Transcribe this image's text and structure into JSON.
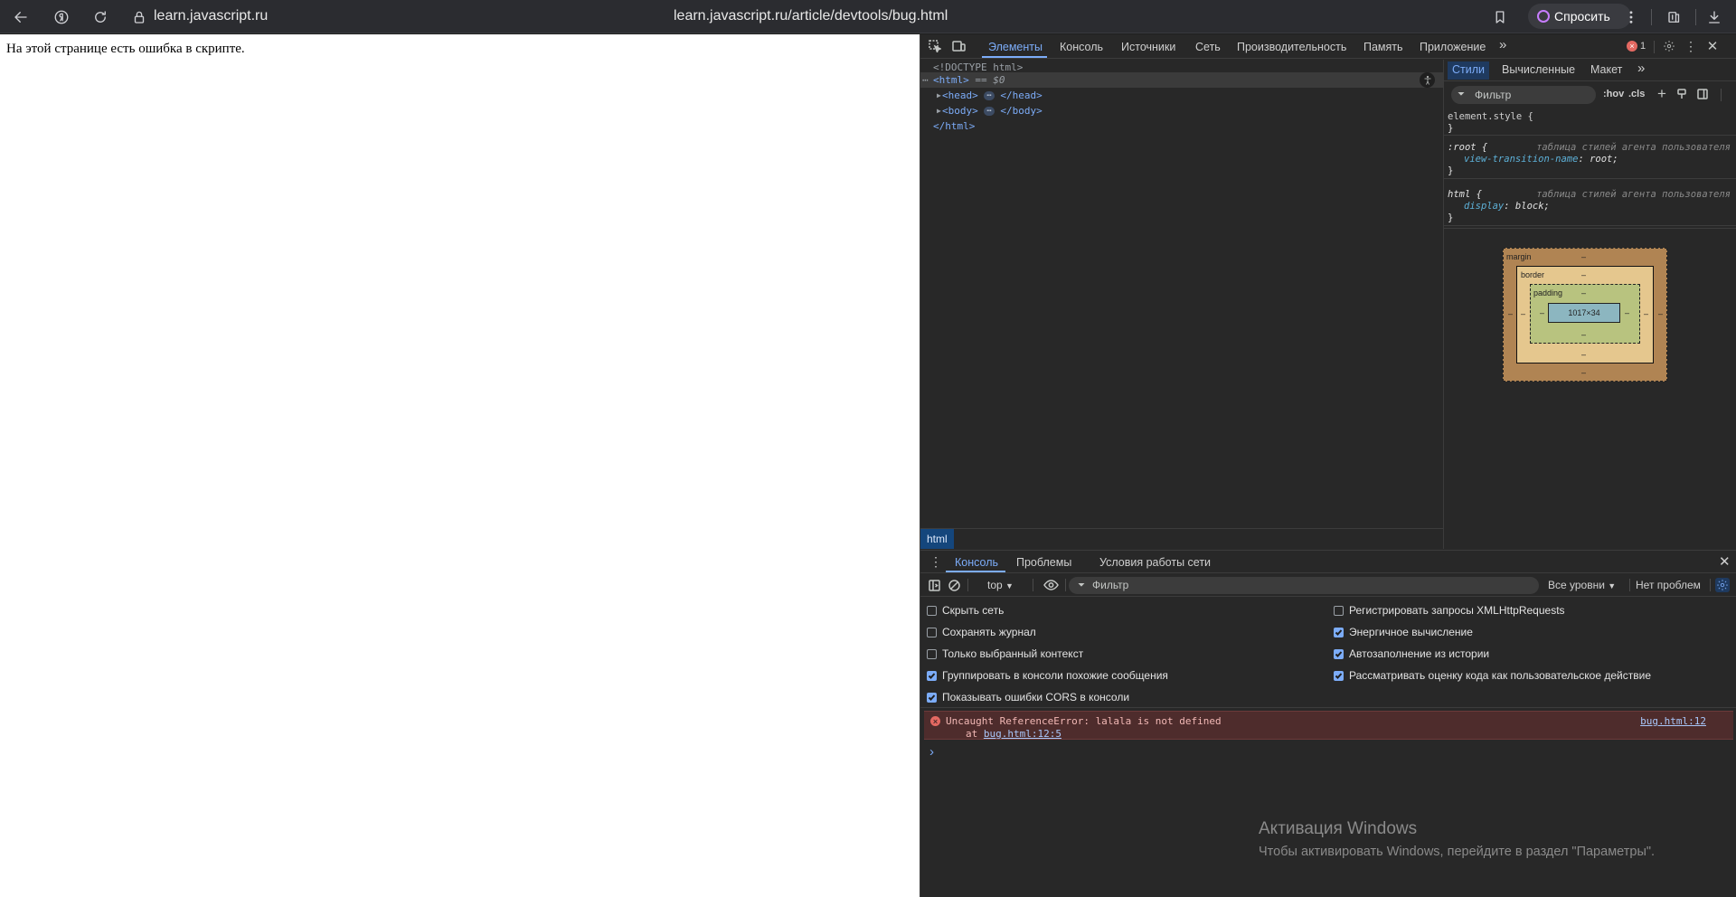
{
  "browser": {
    "site_host": "learn.javascript.ru",
    "url": "learn.javascript.ru/article/devtools/bug.html",
    "ask_label": "Спросить"
  },
  "page": {
    "text": "На этой странице есть ошибка в скрипте."
  },
  "devtools": {
    "tabs": [
      "Элементы",
      "Консоль",
      "Источники",
      "Сеть",
      "Производительность",
      "Память",
      "Приложение"
    ],
    "error_count": "1",
    "dom": {
      "doctype": "<!DOCTYPE html>",
      "html_open": "<html>",
      "selected_marker": "== $0",
      "head": "<head>",
      "head_close": "</head>",
      "body": "<body>",
      "body_close": "</body>",
      "html_close": "</html>",
      "ellipsis": "⋯"
    },
    "breadcrumb": "html",
    "styles": {
      "tabs": [
        "Стили",
        "Вычисленные",
        "Макет"
      ],
      "filter_placeholder": "Фильтр",
      "hov": ":hov",
      "cls": ".cls",
      "rules": [
        {
          "selector": "element.style {",
          "source": "",
          "prop": "",
          "value": "",
          "end": "}"
        },
        {
          "selector": ":root {",
          "source": "таблица стилей агента пользователя",
          "prop": "view-transition-name",
          "value": "root;",
          "end": "}"
        },
        {
          "selector": "html {",
          "source": "таблица стилей агента пользователя",
          "prop": "display",
          "value": "block;",
          "end": "}"
        }
      ],
      "box_model": {
        "margin_label": "margin",
        "border_label": "border",
        "padding_label": "padding",
        "dash": "–",
        "content": "1017×34"
      }
    },
    "console": {
      "tabs": [
        "Консоль",
        "Проблемы",
        "Условия работы сети"
      ],
      "context": "top",
      "filter_placeholder": "Фильтр",
      "levels": "Все уровни",
      "issues": "Нет проблем",
      "options_left": [
        {
          "label": "Скрыть сеть",
          "checked": false
        },
        {
          "label": "Сохранять журнал",
          "checked": false
        },
        {
          "label": "Только выбранный контекст",
          "checked": false
        },
        {
          "label": "Группировать в консоли похожие сообщения",
          "checked": true
        },
        {
          "label": "Показывать ошибки CORS в консоли",
          "checked": true
        }
      ],
      "options_right": [
        {
          "label": "Регистрировать запросы XMLHttpRequests",
          "checked": false
        },
        {
          "label": "Энергичное вычисление",
          "checked": true
        },
        {
          "label": "Автозаполнение из истории",
          "checked": true
        },
        {
          "label": "Рассматривать оценку кода как пользовательское действие",
          "checked": true
        }
      ],
      "error": {
        "message": "Uncaught ReferenceError: lalala is not defined",
        "at_prefix": "at",
        "at_link": "bug.html:12:5",
        "source_link": "bug.html:12"
      },
      "prompt": "›"
    }
  },
  "watermark": {
    "title": "Активация Windows",
    "subtitle": "Чтобы активировать Windows, перейдите в раздел \"Параметры\"."
  }
}
